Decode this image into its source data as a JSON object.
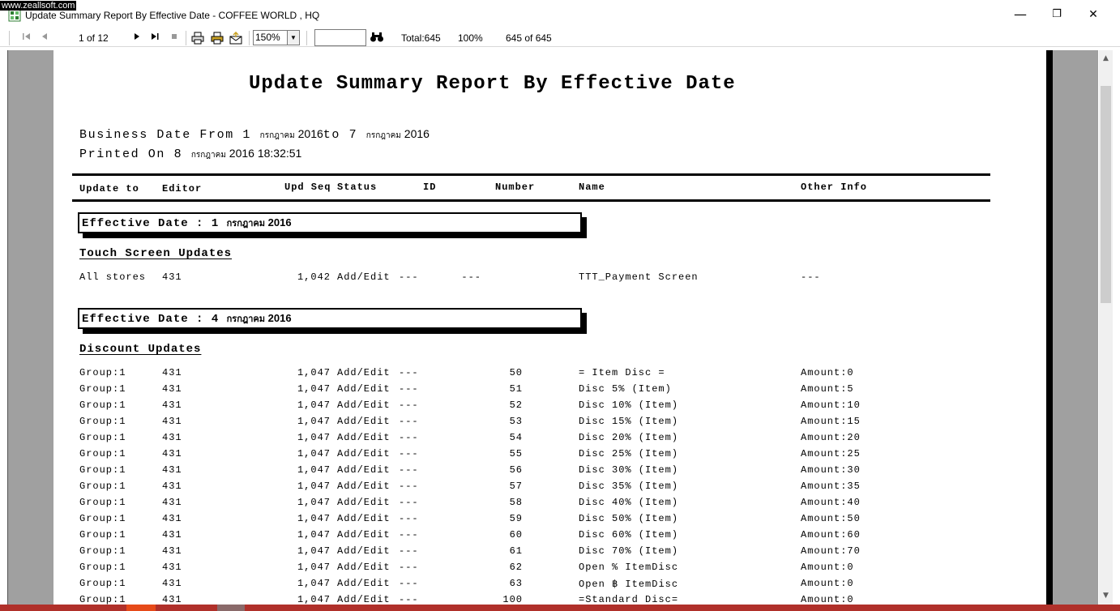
{
  "watermark": "www.zeallsoft.com",
  "window": {
    "title": "Update Summary Report By Effective Date - COFFEE WORLD , HQ",
    "minimize": "—",
    "restore": "❐",
    "close": "✕"
  },
  "toolbar": {
    "page_indicator": "1 of 12",
    "zoom": "150%",
    "search_value": "",
    "total": "Total:645",
    "percent": "100%",
    "record_count": "645 of 645"
  },
  "report": {
    "title": "Update Summary Report By Effective Date",
    "business_date_prefix": "Business Date From 1 ",
    "business_date_month1": "กรกฎาคม",
    "business_date_year1": " 2016",
    "business_date_to": "to 7 ",
    "business_date_month2": "กรกฎาคม",
    "business_date_year2": " 2016",
    "printed_prefix": "Printed On 8 ",
    "printed_month": "กรกฎาคม",
    "printed_rest": " 2016 18:32:51",
    "columns": {
      "update_to": "Update to",
      "editor": "Editor",
      "upd_seq": "Upd Seq",
      "status": "Status",
      "id": "ID",
      "number": "Number",
      "name": "Name",
      "other_info": "Other Info"
    },
    "groups": [
      {
        "effective_prefix": "Effective Date : 1 ",
        "effective_month": "กรกฎาคม",
        "effective_year": " 2016",
        "section": "Touch Screen Updates",
        "rows": [
          {
            "update_to": "All stores",
            "editor": "431",
            "seq": "1,042",
            "status": "Add/Edit",
            "id": "---",
            "number": "---",
            "name": "TTT_Payment Screen",
            "other": "---"
          }
        ]
      },
      {
        "effective_prefix": "Effective Date : 4 ",
        "effective_month": "กรกฎาคม",
        "effective_year": " 2016",
        "section": "Discount Updates",
        "rows": [
          {
            "update_to": "Group:1",
            "editor": "431",
            "seq": "1,047",
            "status": "Add/Edit",
            "id": "---",
            "number": "50",
            "name": "= Item Disc =",
            "other": "Amount:0"
          },
          {
            "update_to": "Group:1",
            "editor": "431",
            "seq": "1,047",
            "status": "Add/Edit",
            "id": "---",
            "number": "51",
            "name": "Disc 5% (Item)",
            "other": "Amount:5"
          },
          {
            "update_to": "Group:1",
            "editor": "431",
            "seq": "1,047",
            "status": "Add/Edit",
            "id": "---",
            "number": "52",
            "name": "Disc 10% (Item)",
            "other": "Amount:10"
          },
          {
            "update_to": "Group:1",
            "editor": "431",
            "seq": "1,047",
            "status": "Add/Edit",
            "id": "---",
            "number": "53",
            "name": "Disc 15% (Item)",
            "other": "Amount:15"
          },
          {
            "update_to": "Group:1",
            "editor": "431",
            "seq": "1,047",
            "status": "Add/Edit",
            "id": "---",
            "number": "54",
            "name": "Disc 20% (Item)",
            "other": "Amount:20"
          },
          {
            "update_to": "Group:1",
            "editor": "431",
            "seq": "1,047",
            "status": "Add/Edit",
            "id": "---",
            "number": "55",
            "name": "Disc 25% (Item)",
            "other": "Amount:25"
          },
          {
            "update_to": "Group:1",
            "editor": "431",
            "seq": "1,047",
            "status": "Add/Edit",
            "id": "---",
            "number": "56",
            "name": "Disc 30% (Item)",
            "other": "Amount:30"
          },
          {
            "update_to": "Group:1",
            "editor": "431",
            "seq": "1,047",
            "status": "Add/Edit",
            "id": "---",
            "number": "57",
            "name": "Disc 35% (Item)",
            "other": "Amount:35"
          },
          {
            "update_to": "Group:1",
            "editor": "431",
            "seq": "1,047",
            "status": "Add/Edit",
            "id": "---",
            "number": "58",
            "name": "Disc 40% (Item)",
            "other": "Amount:40"
          },
          {
            "update_to": "Group:1",
            "editor": "431",
            "seq": "1,047",
            "status": "Add/Edit",
            "id": "---",
            "number": "59",
            "name": "Disc 50% (Item)",
            "other": "Amount:50"
          },
          {
            "update_to": "Group:1",
            "editor": "431",
            "seq": "1,047",
            "status": "Add/Edit",
            "id": "---",
            "number": "60",
            "name": "Disc 60% (Item)",
            "other": "Amount:60"
          },
          {
            "update_to": "Group:1",
            "editor": "431",
            "seq": "1,047",
            "status": "Add/Edit",
            "id": "---",
            "number": "61",
            "name": "Disc 70% (Item)",
            "other": "Amount:70"
          },
          {
            "update_to": "Group:1",
            "editor": "431",
            "seq": "1,047",
            "status": "Add/Edit",
            "id": "---",
            "number": "62",
            "name": "Open % ItemDisc",
            "other": "Amount:0"
          },
          {
            "update_to": "Group:1",
            "editor": "431",
            "seq": "1,047",
            "status": "Add/Edit",
            "id": "---",
            "number": "63",
            "name": "Open ฿ ItemDisc",
            "other": "Amount:0"
          },
          {
            "update_to": "Group:1",
            "editor": "431",
            "seq": "1,047",
            "status": "Add/Edit",
            "id": "---",
            "number": "100",
            "name": "=Standard Disc=",
            "other": "Amount:0"
          }
        ]
      }
    ]
  }
}
